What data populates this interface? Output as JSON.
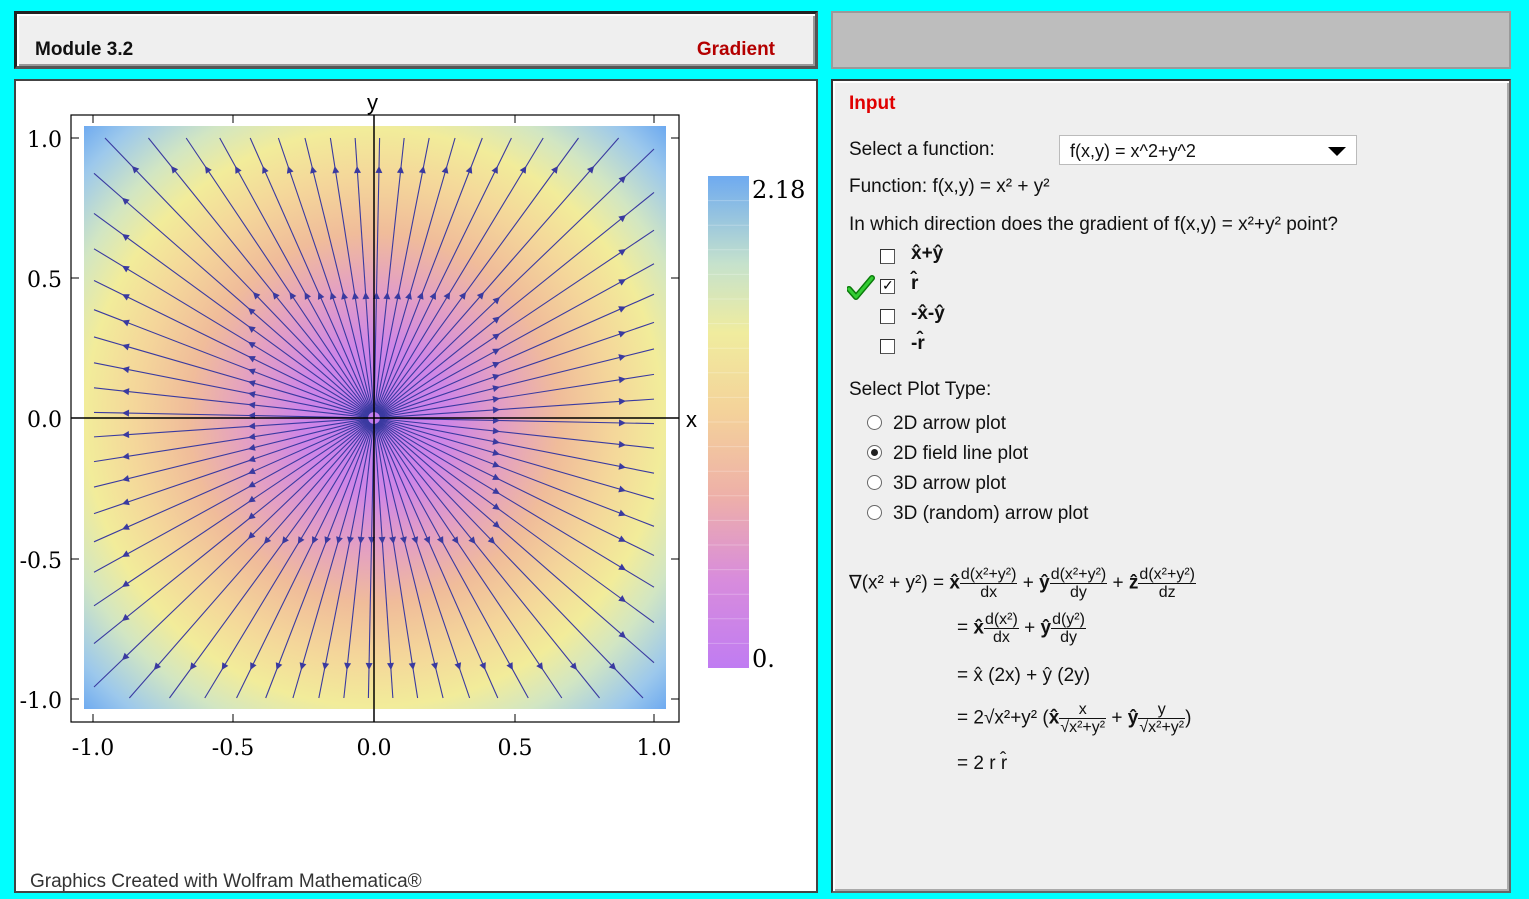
{
  "header": {
    "module": "Module 3.2",
    "topic": "Gradient"
  },
  "plot": {
    "x_axis_label": "x",
    "y_axis_label": "y",
    "x_ticks": [
      "-1.0",
      "-0.5",
      "0.0",
      "0.5",
      "1.0"
    ],
    "y_ticks": [
      "1.0",
      "0.5",
      "0.0",
      "-0.5",
      "-1.0"
    ],
    "colorbar_max": "2.18",
    "colorbar_min": "0.",
    "credit": "Graphics Created with Wolfram Mathematica®"
  },
  "input": {
    "title": "Input",
    "select_label": "Select a function:",
    "selected_function": "f(x,y) = x^2+y^2",
    "function_prefix": "Function:",
    "function_display": "f(x,y) = x² + y²",
    "question": "In which direction does the gradient of f(x,y) = x²+y² point?",
    "options": [
      {
        "label": "x̂+ŷ",
        "checked": false
      },
      {
        "label": "r̂",
        "checked": true
      },
      {
        "label": "-x̂-ŷ",
        "checked": false
      },
      {
        "label": "-r̂",
        "checked": false
      }
    ],
    "plot_type_label": "Select Plot Type:",
    "plot_types": [
      {
        "label": "2D arrow plot",
        "selected": false
      },
      {
        "label": "2D field line plot",
        "selected": true
      },
      {
        "label": "3D arrow plot",
        "selected": false
      },
      {
        "label": "3D (random) arrow plot",
        "selected": false
      }
    ]
  },
  "derivation": {
    "lhs": "∇(x² + y²) =",
    "line1_num": "d(x²+y²)",
    "den_dx": "dx",
    "den_dy": "dy",
    "den_dz": "dz",
    "line2_num_x": "d(x²)",
    "line2_num_y": "d(y²)",
    "line3": "= x̂ (2x) + ŷ (2y)",
    "line4_prefix": "= 2√x²+y² (",
    "line4_num_x": "x",
    "line4_num_y": "y",
    "line4_den": "√x²+y²",
    "line5": "= 2 r r̂"
  },
  "colors": {
    "frame": "#00ffff",
    "accent_red": "#e00000",
    "arrow_color": "#3a3aa0"
  }
}
